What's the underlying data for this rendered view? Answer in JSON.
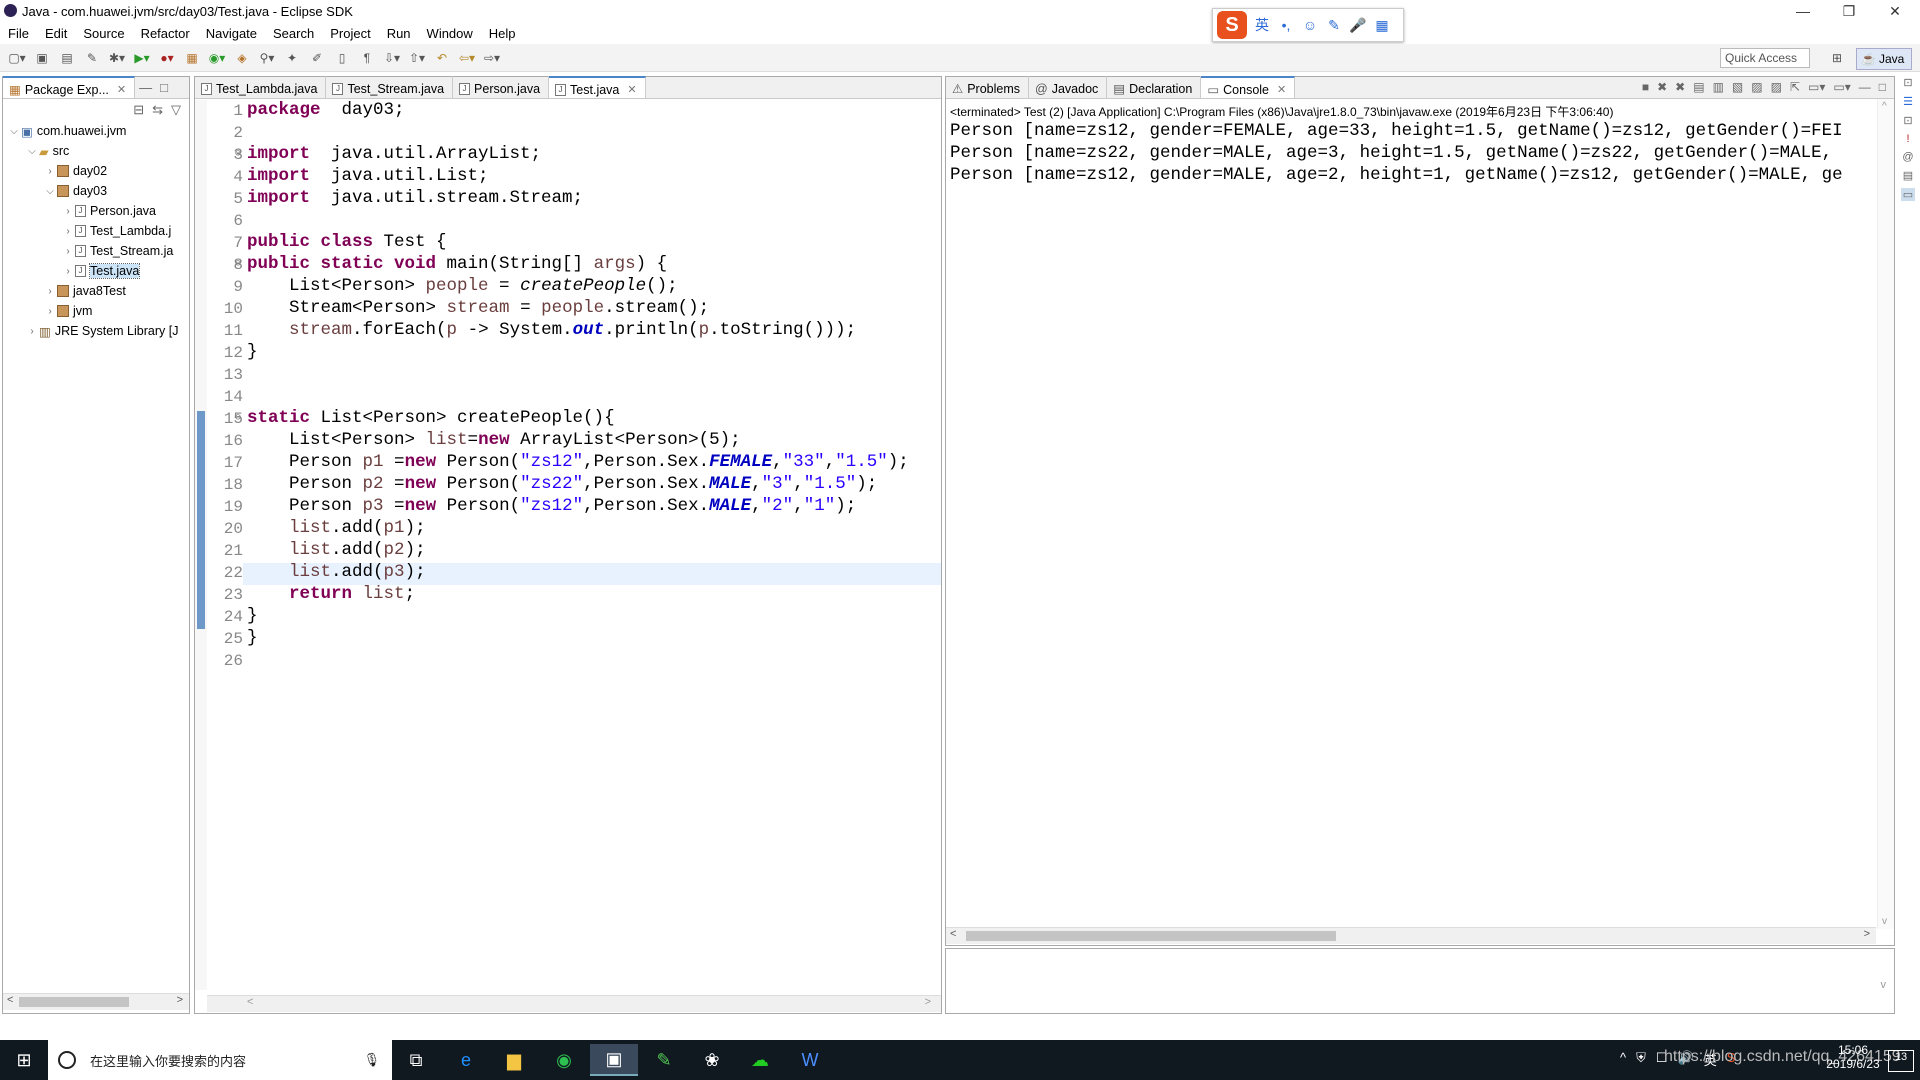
{
  "window": {
    "title": "Java - com.huawei.jvm/src/day03/Test.java - Eclipse SDK",
    "min": "—",
    "max": "❐",
    "close": "✕"
  },
  "menu": [
    "File",
    "Edit",
    "Source",
    "Refactor",
    "Navigate",
    "Search",
    "Project",
    "Run",
    "Window",
    "Help"
  ],
  "ime": {
    "logo": "S",
    "mode": "英",
    "punct": "•,",
    "emoji": "☺",
    "pen": "✎",
    "mic": "🎤",
    "grid": "▦"
  },
  "quick_access": "Quick Access",
  "perspective": "Java",
  "package_explorer": {
    "tab": "Package Exp...",
    "items": [
      {
        "label": "com.huawei.jvm",
        "indent": 0,
        "tw": "v",
        "kind": "project"
      },
      {
        "label": "src",
        "indent": 1,
        "tw": "v",
        "kind": "src"
      },
      {
        "label": "day02",
        "indent": 2,
        "tw": ">",
        "kind": "pkg"
      },
      {
        "label": "day03",
        "indent": 2,
        "tw": "v",
        "kind": "pkg"
      },
      {
        "label": "Person.java",
        "indent": 3,
        "tw": ">",
        "kind": "file"
      },
      {
        "label": "Test_Lambda.j",
        "indent": 3,
        "tw": ">",
        "kind": "file"
      },
      {
        "label": "Test_Stream.ja",
        "indent": 3,
        "tw": ">",
        "kind": "file"
      },
      {
        "label": "Test.java",
        "indent": 3,
        "tw": ">",
        "kind": "file",
        "selected": true
      },
      {
        "label": "java8Test",
        "indent": 2,
        "tw": ">",
        "kind": "pkg"
      },
      {
        "label": "jvm",
        "indent": 2,
        "tw": ">",
        "kind": "pkg"
      },
      {
        "label": "JRE System Library [J",
        "indent": 1,
        "tw": ">",
        "kind": "lib"
      }
    ]
  },
  "editor": {
    "tabs": [
      {
        "label": "Test_Lambda.java"
      },
      {
        "label": "Test_Stream.java"
      },
      {
        "label": "Person.java"
      },
      {
        "label": "Test.java",
        "active": true
      }
    ],
    "line_numbers": [
      "1",
      "2",
      "3",
      "4",
      "5",
      "6",
      "7",
      "8",
      "9",
      "10",
      "11",
      "12",
      "13",
      "14",
      "15",
      "16",
      "17",
      "18",
      "19",
      "20",
      "21",
      "22",
      "23",
      "24",
      "25",
      "26"
    ],
    "lines": [
      [
        [
          "kw",
          "package"
        ],
        [
          "",
          "  day03;"
        ]
      ],
      [],
      [
        [
          "kw",
          "import"
        ],
        [
          "",
          "  java.util.ArrayList;"
        ]
      ],
      [
        [
          "kw",
          "import"
        ],
        [
          "",
          "  java.util.List;"
        ]
      ],
      [
        [
          "kw",
          "import"
        ],
        [
          "",
          "  java.util.stream.Stream;"
        ]
      ],
      [],
      [
        [
          "kw",
          "public class"
        ],
        [
          "",
          " Test {"
        ]
      ],
      [
        [
          "kw",
          "public static void"
        ],
        [
          "",
          " main(String[] "
        ],
        [
          "var",
          "args"
        ],
        [
          "",
          ") {"
        ]
      ],
      [
        [
          "",
          "    List<Person> "
        ],
        [
          "var",
          "people"
        ],
        [
          "",
          " = "
        ],
        [
          "it",
          "createPeople"
        ],
        [
          "",
          "();"
        ]
      ],
      [
        [
          "",
          "    Stream<Person> "
        ],
        [
          "var",
          "stream"
        ],
        [
          "",
          " = "
        ],
        [
          "var",
          "people"
        ],
        [
          "",
          ".stream();"
        ]
      ],
      [
        [
          "",
          "    "
        ],
        [
          "var",
          "stream"
        ],
        [
          "",
          ".forEach("
        ],
        [
          "var",
          "p"
        ],
        [
          "",
          " -> System."
        ],
        [
          "ff",
          "out"
        ],
        [
          "",
          ".println("
        ],
        [
          "var",
          "p"
        ],
        [
          "",
          ".toString()));"
        ]
      ],
      [
        [
          "",
          "}"
        ]
      ],
      [],
      [],
      [
        [
          "kw",
          "static"
        ],
        [
          "",
          " List<Person> createPeople(){"
        ]
      ],
      [
        [
          "",
          "    List<Person> "
        ],
        [
          "var",
          "list"
        ],
        [
          "",
          "="
        ],
        [
          "kw",
          "new"
        ],
        [
          "",
          " ArrayList<Person>(5);"
        ]
      ],
      [
        [
          "",
          "    Person "
        ],
        [
          "var",
          "p1"
        ],
        [
          "",
          " ="
        ],
        [
          "kw",
          "new"
        ],
        [
          "",
          " Person("
        ],
        [
          "str",
          "\"zs12\""
        ],
        [
          "",
          ",Person.Sex."
        ],
        [
          "fld",
          "FEMALE"
        ],
        [
          "",
          ","
        ],
        [
          "str",
          "\"33\""
        ],
        [
          "",
          ","
        ],
        [
          "str",
          "\"1.5\""
        ],
        [
          "",
          ");"
        ]
      ],
      [
        [
          "",
          "    Person "
        ],
        [
          "var",
          "p2"
        ],
        [
          "",
          " ="
        ],
        [
          "kw",
          "new"
        ],
        [
          "",
          " Person("
        ],
        [
          "str",
          "\"zs22\""
        ],
        [
          "",
          ",Person.Sex."
        ],
        [
          "fld",
          "MALE"
        ],
        [
          "",
          ","
        ],
        [
          "str",
          "\"3\""
        ],
        [
          "",
          ","
        ],
        [
          "str",
          "\"1.5\""
        ],
        [
          "",
          ");"
        ]
      ],
      [
        [
          "",
          "    Person "
        ],
        [
          "var",
          "p3"
        ],
        [
          "",
          " ="
        ],
        [
          "kw",
          "new"
        ],
        [
          "",
          " Person("
        ],
        [
          "str",
          "\"zs12\""
        ],
        [
          "",
          ",Person.Sex."
        ],
        [
          "fld",
          "MALE"
        ],
        [
          "",
          ","
        ],
        [
          "str",
          "\"2\""
        ],
        [
          "",
          ","
        ],
        [
          "str",
          "\"1\""
        ],
        [
          "",
          ");"
        ]
      ],
      [
        [
          "",
          "    "
        ],
        [
          "var",
          "list"
        ],
        [
          "",
          ".add("
        ],
        [
          "var",
          "p1"
        ],
        [
          "",
          ");"
        ]
      ],
      [
        [
          "",
          "    "
        ],
        [
          "var",
          "list"
        ],
        [
          "",
          ".add("
        ],
        [
          "var",
          "p2"
        ],
        [
          "",
          ");"
        ]
      ],
      [
        [
          "",
          "    "
        ],
        [
          "var",
          "list"
        ],
        [
          "",
          ".add("
        ],
        [
          "var",
          "p3"
        ],
        [
          "",
          ");"
        ]
      ],
      [
        [
          "",
          "    "
        ],
        [
          "kw",
          "return"
        ],
        [
          "",
          " "
        ],
        [
          "var",
          "list"
        ],
        [
          "",
          ";"
        ]
      ],
      [
        [
          "",
          "}"
        ]
      ],
      [
        [
          "",
          "}"
        ]
      ],
      []
    ]
  },
  "console": {
    "tabs": [
      {
        "label": "Problems"
      },
      {
        "label": "Javadoc"
      },
      {
        "label": "Declaration"
      },
      {
        "label": "Console",
        "active": true
      }
    ],
    "status": "<terminated> Test (2) [Java Application] C:\\Program Files (x86)\\Java\\jre1.8.0_73\\bin\\javaw.exe (2019年6月23日 下午3:06:40)",
    "lines": [
      "Person [name=zs12, gender=FEMALE, age=33, height=1.5, getName()=zs12, getGender()=FEI",
      "Person [name=zs22, gender=MALE, age=3, height=1.5, getName()=zs22, getGender()=MALE,",
      "Person [name=zs12, gender=MALE, age=2, height=1, getName()=zs12, getGender()=MALE, ge"
    ]
  },
  "taskbar": {
    "search_placeholder": "在这里输入你要搜索的内容",
    "time": "15:06",
    "date": "2019/6/23",
    "ime": "英",
    "notif": "13",
    "watermark": "https://blog.csdn.net/qq_4264159"
  }
}
